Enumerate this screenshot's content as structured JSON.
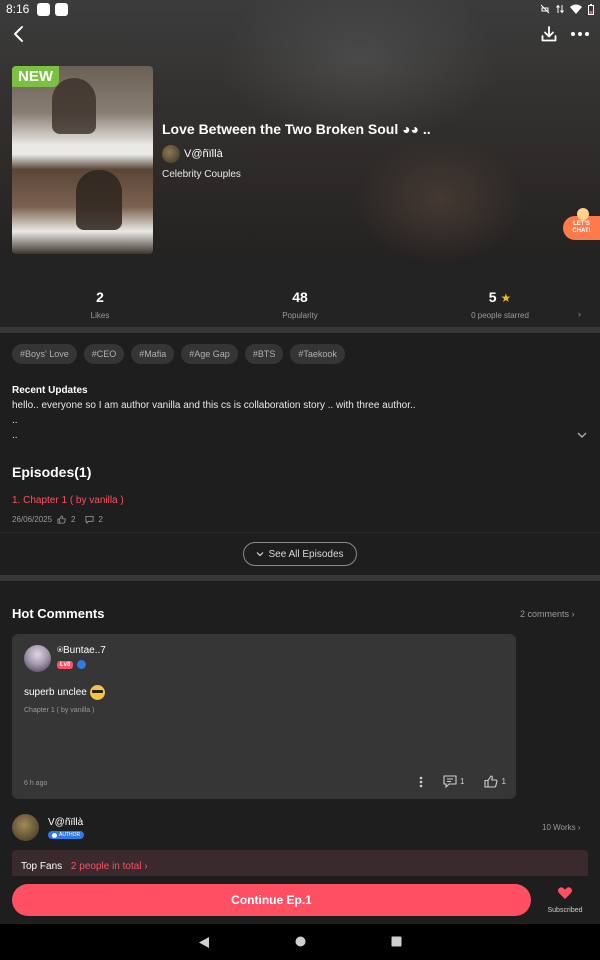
{
  "status_bar": {
    "time": "8:16"
  },
  "story": {
    "badge": "NEW",
    "title": "Love Between the Two Broken Soul ◕◕ ..",
    "author": "V@ñïllà",
    "category": "Celebrity Couples"
  },
  "chat_bubble": {
    "line1": "LET'S",
    "line2": "CHAT!"
  },
  "stats": {
    "likes_value": "2",
    "likes_label": "Likes",
    "popularity_value": "48",
    "popularity_label": "Popularity",
    "rating_value": "5",
    "rating_label": "0 people starred"
  },
  "tags": [
    "#Boys' Love",
    "#CEO",
    "#Mafia",
    "#Age Gap",
    "#BTS",
    "#Taekook"
  ],
  "recent_updates": {
    "title": "Recent Updates",
    "lines": [
      "hello.. everyone so I am author vanilla and this cs is collaboration story .. with three author..",
      "..",
      ".."
    ]
  },
  "episodes": {
    "title": "Episodes(1)",
    "items": [
      {
        "title": "1. Chapter 1 ( by vanilla )",
        "date": "26/06/2025",
        "likes": "2",
        "comments": "2"
      }
    ],
    "see_all": "See All Episodes"
  },
  "hot_comments": {
    "title": "Hot Comments",
    "count_link": "2 comments",
    "items": [
      {
        "user": "⍟Buntae..7",
        "level": "Lv8",
        "text": "superb unclee",
        "chapter": "Chapter 1 ( by vanilla )",
        "time": "6 h ago",
        "reply_count": "1",
        "like_count": "1"
      }
    ]
  },
  "author_section": {
    "name": "V@ñïllà",
    "badge": "AUTHOR",
    "works": "10 Works"
  },
  "top_fans": {
    "label": "Top Fans",
    "link": "2 people in total"
  },
  "bottom": {
    "continue_label": "Continue Ep.1",
    "subscribed_label": "Subscribed"
  },
  "colors": {
    "accent": "#ff4f63",
    "new_badge": "#7bc043",
    "star": "#f5b921",
    "verified": "#2f7ae5"
  }
}
